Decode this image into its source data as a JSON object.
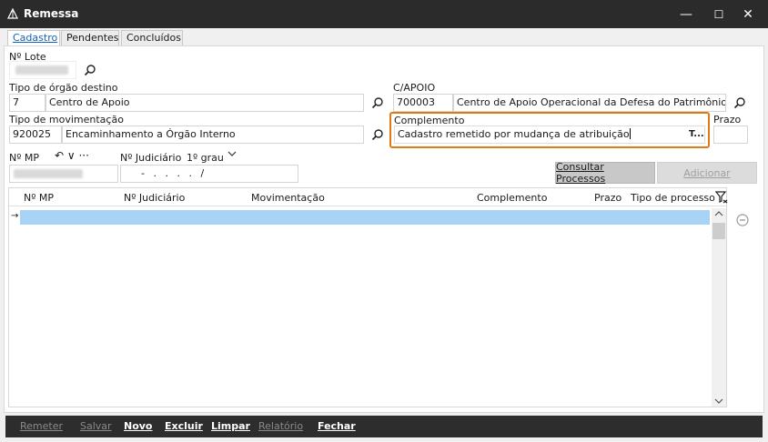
{
  "window": {
    "title": "Remessa",
    "controls": {
      "minimize": "—",
      "maximize": "☐",
      "close": "✕"
    }
  },
  "tabs": [
    {
      "label": "Cadastro",
      "active": true
    },
    {
      "label": "Pendentes",
      "active": false
    },
    {
      "label": "Concluídos",
      "active": false
    }
  ],
  "form": {
    "lote": {
      "label": "Nº Lote"
    },
    "orgao_destino": {
      "label": "Tipo de órgão destino",
      "code": "7",
      "name": "Centro de Apoio"
    },
    "capoio": {
      "label": "C/APOIO",
      "code": "700003",
      "name": "Centro de Apoio Operacional da Defesa do Patrimônio Púb"
    },
    "movimentacao": {
      "label": "Tipo de movimentação",
      "code": "920025",
      "name": "Encaminhamento a Órgão Interno"
    },
    "complemento": {
      "label": "Complemento",
      "value": "Cadastro remetido por mudança de atribuição",
      "suffix": "T..."
    },
    "prazo": {
      "label": "Prazo"
    },
    "nmp": {
      "label": "Nº MP",
      "tools": "↶ ∨ ···"
    },
    "judiciario": {
      "label": "Nº Judiciário",
      "grau": "1º grau",
      "mask": "- . . . . /"
    }
  },
  "buttons": {
    "consultar": "Consultar Processos",
    "adicionar": "Adicionar"
  },
  "grid": {
    "columns": [
      "Nº MP",
      "Nº Judiciário",
      "Movimentação",
      "Complemento",
      "Prazo",
      "Tipo de processo"
    ],
    "row_marker": "→"
  },
  "footer": [
    {
      "label": "Remeter",
      "enabled": false
    },
    {
      "label": "Salvar",
      "enabled": false
    },
    {
      "label": "Novo",
      "enabled": true
    },
    {
      "label": "Excluir",
      "enabled": true
    },
    {
      "label": "Limpar",
      "enabled": true
    },
    {
      "label": "Relatório",
      "enabled": false
    },
    {
      "label": "Fechar",
      "enabled": true
    }
  ],
  "colors": {
    "titlebar": "#2b2b2b",
    "accent_tab": "#1560bd",
    "highlight_border": "#e07b14",
    "selection": "#a9d3f5",
    "footer": "#2d2d2d"
  },
  "icons": {
    "app": "scales-icon",
    "search": "search-icon",
    "filter": "filter-icon",
    "remove": "minus-circle-icon"
  }
}
